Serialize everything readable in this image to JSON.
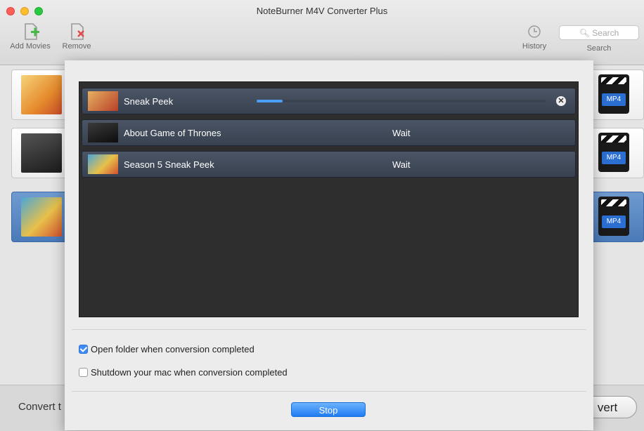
{
  "window": {
    "title": "NoteBurner M4V Converter Plus"
  },
  "toolbar": {
    "add_label": "Add Movies",
    "remove_label": "Remove",
    "history_label": "History",
    "search_label": "Search",
    "search_placeholder": "Search"
  },
  "movies": [
    {
      "format": "MP4",
      "selected": false
    },
    {
      "format": "MP4",
      "selected": false
    },
    {
      "format": "MP4",
      "selected": true
    }
  ],
  "bottom": {
    "convert_label": "Convert t",
    "convert_button": "vert"
  },
  "queue": {
    "items": [
      {
        "name": "Sneak Peek",
        "status": "",
        "progress": 0.09
      },
      {
        "name": "About Game of Thrones",
        "status": "Wait"
      },
      {
        "name": "Season 5 Sneak Peek",
        "status": "Wait"
      }
    ]
  },
  "options": {
    "open_folder": {
      "label": "Open folder when conversion completed",
      "checked": true
    },
    "shutdown": {
      "label": "Shutdown your mac when conversion completed",
      "checked": false
    }
  },
  "buttons": {
    "stop": "Stop"
  },
  "colors": {
    "accent": "#2f7ff0",
    "queue_bg": "#2e2e2e",
    "row": "#404a59"
  }
}
